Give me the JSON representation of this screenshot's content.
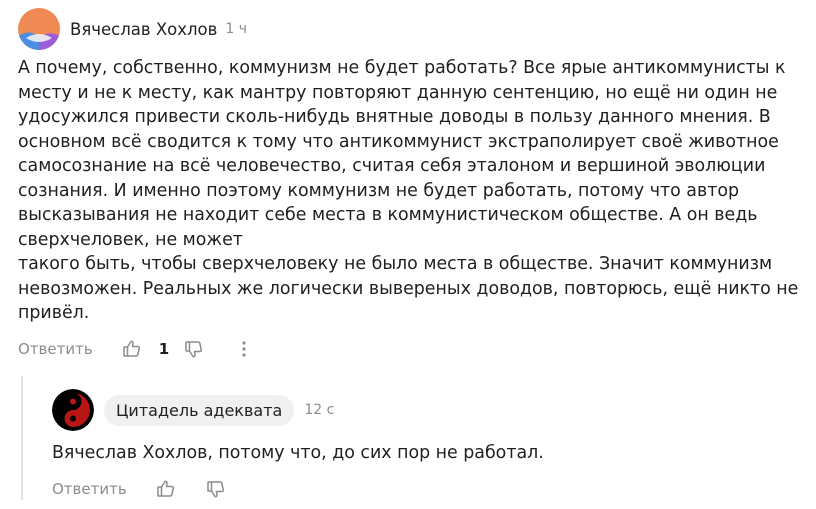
{
  "comment": {
    "author": "Вячеслав Хохлов",
    "time": "1 ч",
    "lines": [
      "А почему, собственно, коммунизм не будет работать? Все ярые антикоммунисты к",
      "месту и не к месту, как мантру повторяют данную сентенцию, но ещё ни один не",
      "удосужился привести сколь-нибудь внятные доводы в пользу данного мнения. В",
      "основном всё сводится к тому что антикоммунист экстраполирует своё животное",
      "самосознание на всё человечество, считая себя эталоном и вершиной эволюции",
      "сознания. И именно поэтому коммунизм не будет работать, потому что автор",
      "высказывания не находит себе места в коммунистическом обществе. А он ведь",
      "сверхчеловек, не может",
      "такого быть, чтобы сверхчеловеку не было места в обществе. Значит коммунизм",
      "невозможен. Реальных же логически вывереных доводов, повторюсь, ещё никто не",
      "привёл."
    ],
    "reply_label": "Ответить",
    "likes": "1"
  },
  "reply": {
    "author": "Цитадель адеквата",
    "time": "12 с",
    "text": "Вячеслав Хохлов, потому что, до сих пор не работал.",
    "reply_label": "Ответить"
  },
  "colors": {
    "muted": "#8c8c8c",
    "chip_bg": "#f0f0f0",
    "avatar_orange": "#f08a55",
    "avatar_blue": "#4c8ee0",
    "avatar_purple": "#9a5ed8",
    "avatar_red": "#b81515"
  }
}
